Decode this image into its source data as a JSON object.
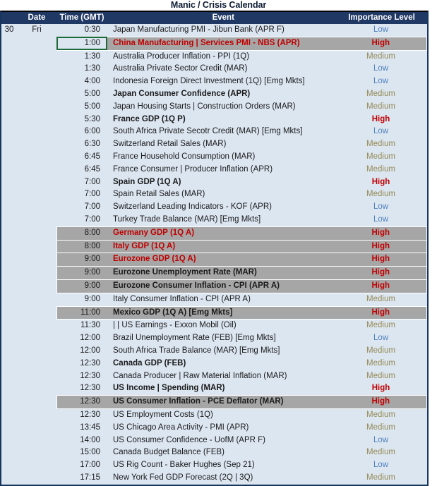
{
  "title": "Manic / Crisis Calendar",
  "columns": {
    "date": "Date",
    "time": "Time (GMT)",
    "event": "Event",
    "importance": "Importance Level"
  },
  "colors": {
    "header_bg": "#1f3864",
    "row_bg": "#dce6f1",
    "highlight_bg": "#a6a6a6",
    "low": "#4f81bd",
    "medium": "#948a54",
    "high": "#c00000",
    "selection_border": "#1e6b3a"
  },
  "rows": [
    {
      "daynum": "30",
      "dow": "Fri",
      "time": "0:30",
      "event": "Japan Manufacturing PMI - Jibun Bank (APR F)",
      "importance": "Low",
      "style": "normal",
      "highlight": false,
      "selected": false
    },
    {
      "daynum": "",
      "dow": "",
      "time": "1:00",
      "event": "China Manufacturing | Services PMI - NBS (APR)",
      "importance": "High",
      "style": "red",
      "highlight": true,
      "selected": true
    },
    {
      "daynum": "",
      "dow": "",
      "time": "1:30",
      "event": "Australia Producer Inflation - PPI (1Q)",
      "importance": "Medium",
      "style": "normal",
      "highlight": false,
      "selected": false
    },
    {
      "daynum": "",
      "dow": "",
      "time": "1:30",
      "event": "Australia Private Sector Credit (MAR)",
      "importance": "Low",
      "style": "normal",
      "highlight": false,
      "selected": false
    },
    {
      "daynum": "",
      "dow": "",
      "time": "4:00",
      "event": "Indonesia Foreign Direct Investment (1Q) [Emg Mkts]",
      "importance": "Low",
      "style": "normal",
      "highlight": false,
      "selected": false
    },
    {
      "daynum": "",
      "dow": "",
      "time": "5:00",
      "event": "Japan Consumer Confidence (APR)",
      "importance": "Medium",
      "style": "bold",
      "highlight": false,
      "selected": false
    },
    {
      "daynum": "",
      "dow": "",
      "time": "5:00",
      "event": "Japan Housing Starts | Construction Orders (MAR)",
      "importance": "Medium",
      "style": "normal",
      "highlight": false,
      "selected": false
    },
    {
      "daynum": "",
      "dow": "",
      "time": "5:30",
      "event": "France GDP (1Q P)",
      "importance": "High",
      "style": "bold",
      "highlight": false,
      "selected": false
    },
    {
      "daynum": "",
      "dow": "",
      "time": "6:00",
      "event": "South Africa Private Secotr Credit (MAR) [Emg Mkts]",
      "importance": "Low",
      "style": "normal",
      "highlight": false,
      "selected": false
    },
    {
      "daynum": "",
      "dow": "",
      "time": "6:30",
      "event": "Switzerland Retail Sales (MAR)",
      "importance": "Medium",
      "style": "normal",
      "highlight": false,
      "selected": false
    },
    {
      "daynum": "",
      "dow": "",
      "time": "6:45",
      "event": "France Household Consumption (MAR)",
      "importance": "Medium",
      "style": "normal",
      "highlight": false,
      "selected": false
    },
    {
      "daynum": "",
      "dow": "",
      "time": "6:45",
      "event": "France Consumer | Producer Inflation (APR)",
      "importance": "Medium",
      "style": "normal",
      "highlight": false,
      "selected": false
    },
    {
      "daynum": "",
      "dow": "",
      "time": "7:00",
      "event": "Spain GDP (1Q A)",
      "importance": "High",
      "style": "bold",
      "highlight": false,
      "selected": false
    },
    {
      "daynum": "",
      "dow": "",
      "time": "7:00",
      "event": "Spain Retail Sales (MAR)",
      "importance": "Medium",
      "style": "normal",
      "highlight": false,
      "selected": false
    },
    {
      "daynum": "",
      "dow": "",
      "time": "7:00",
      "event": "Switzerland Leading Indicators - KOF (APR)",
      "importance": "Low",
      "style": "normal",
      "highlight": false,
      "selected": false
    },
    {
      "daynum": "",
      "dow": "",
      "time": "7:00",
      "event": "Turkey Trade Balance (MAR) [Emg Mkts]",
      "importance": "Low",
      "style": "normal",
      "highlight": false,
      "selected": false
    },
    {
      "daynum": "",
      "dow": "",
      "time": "8:00",
      "event": "Germany GDP (1Q A)",
      "importance": "High",
      "style": "red",
      "highlight": true,
      "selected": false
    },
    {
      "daynum": "",
      "dow": "",
      "time": "8:00",
      "event": "Italy GDP (1Q A)",
      "importance": "High",
      "style": "red",
      "highlight": true,
      "selected": false
    },
    {
      "daynum": "",
      "dow": "",
      "time": "9:00",
      "event": "Eurozone GDP (1Q A)",
      "importance": "High",
      "style": "red",
      "highlight": true,
      "selected": false
    },
    {
      "daynum": "",
      "dow": "",
      "time": "9:00",
      "event": "Eurozone Unemployment Rate (MAR)",
      "importance": "High",
      "style": "bold",
      "highlight": true,
      "selected": false
    },
    {
      "daynum": "",
      "dow": "",
      "time": "9:00",
      "event": "Eurozone Consumer Inflation - CPI (APR A)",
      "importance": "High",
      "style": "bold",
      "highlight": true,
      "selected": false
    },
    {
      "daynum": "",
      "dow": "",
      "time": "9:00",
      "event": "Italy Consumer Inflation - CPI (APR A)",
      "importance": "Medium",
      "style": "normal",
      "highlight": false,
      "selected": false
    },
    {
      "daynum": "",
      "dow": "",
      "time": "11:00",
      "event": "Mexico GDP (1Q A) [Emg Mkts]",
      "importance": "High",
      "style": "bold",
      "highlight": true,
      "selected": false
    },
    {
      "daynum": "",
      "dow": "",
      "time": "11:30",
      "event": "| | US Earnings - Exxon Mobil (Oil)",
      "importance": "Medium",
      "style": "normal",
      "highlight": false,
      "selected": false
    },
    {
      "daynum": "",
      "dow": "",
      "time": "12:00",
      "event": "Brazil Unemployment Rate (FEB) [Emg Mkts]",
      "importance": "Low",
      "style": "normal",
      "highlight": false,
      "selected": false
    },
    {
      "daynum": "",
      "dow": "",
      "time": "12:00",
      "event": "South Africa Trade Balance (MAR) [Emg Mkts]",
      "importance": "Medium",
      "style": "normal",
      "highlight": false,
      "selected": false
    },
    {
      "daynum": "",
      "dow": "",
      "time": "12:30",
      "event": "Canada GDP (FEB)",
      "importance": "Medium",
      "style": "bold",
      "highlight": false,
      "selected": false
    },
    {
      "daynum": "",
      "dow": "",
      "time": "12:30",
      "event": "Canada Producer | Raw Material Inflation (MAR)",
      "importance": "Medium",
      "style": "normal",
      "highlight": false,
      "selected": false
    },
    {
      "daynum": "",
      "dow": "",
      "time": "12:30",
      "event": "US Income | Spending (MAR)",
      "importance": "High",
      "style": "bold",
      "highlight": false,
      "selected": false
    },
    {
      "daynum": "",
      "dow": "",
      "time": "12:30",
      "event": "US Consumer Inflation - PCE Deflator (MAR)",
      "importance": "High",
      "style": "bold",
      "highlight": true,
      "selected": false
    },
    {
      "daynum": "",
      "dow": "",
      "time": "12:30",
      "event": "US Employment Costs (1Q)",
      "importance": "Medium",
      "style": "normal",
      "highlight": false,
      "selected": false
    },
    {
      "daynum": "",
      "dow": "",
      "time": "13:45",
      "event": "US Chicago Area Activity - PMI (APR)",
      "importance": "Medium",
      "style": "normal",
      "highlight": false,
      "selected": false
    },
    {
      "daynum": "",
      "dow": "",
      "time": "14:00",
      "event": "US Consumer Confidence - UofM (APR F)",
      "importance": "Low",
      "style": "normal",
      "highlight": false,
      "selected": false
    },
    {
      "daynum": "",
      "dow": "",
      "time": "15:00",
      "event": "Canada Budget Balance (FEB)",
      "importance": "Medium",
      "style": "normal",
      "highlight": false,
      "selected": false
    },
    {
      "daynum": "",
      "dow": "",
      "time": "17:00",
      "event": "US Rig Count - Baker Hughes (Sep 21)",
      "importance": "Low",
      "style": "normal",
      "highlight": false,
      "selected": false
    },
    {
      "daynum": "",
      "dow": "",
      "time": "17:15",
      "event": "New York Fed GDP Forecast (2Q | 3Q)",
      "importance": "Medium",
      "style": "normal",
      "highlight": false,
      "selected": false
    }
  ]
}
